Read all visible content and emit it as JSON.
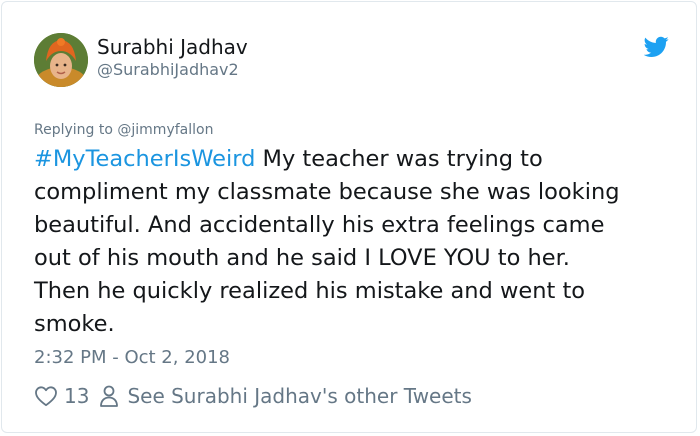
{
  "tweet": {
    "author": {
      "display_name": "Surabhi Jadhav",
      "handle": "@SurabhiJadhav2"
    },
    "replying_to_prefix": "Replying to ",
    "replying_to_handle": "@jimmyfallon",
    "hashtag": "#MyTeacherIsWeird",
    "text_lines": [
      " My teacher was trying to",
      "compliment my classmate because she was looking",
      "beautiful. And accidentally his extra feelings came",
      "out of his mouth and he said I LOVE YOU to her.",
      "Then he quickly realized his mistake and went to",
      "smoke."
    ],
    "timestamp": "2:32 PM - Oct 2, 2018",
    "likes": "13",
    "other_tweets_link": "See Surabhi Jadhav's other Tweets"
  },
  "icons": {
    "brand": "twitter-bird-icon",
    "like": "heart-icon",
    "profile": "person-icon"
  },
  "colors": {
    "link": "#1b95e0",
    "secondary_text": "#657786",
    "primary_text": "#14171a",
    "twitter_blue": "#1da1f2",
    "border": "#e1e8ed"
  }
}
